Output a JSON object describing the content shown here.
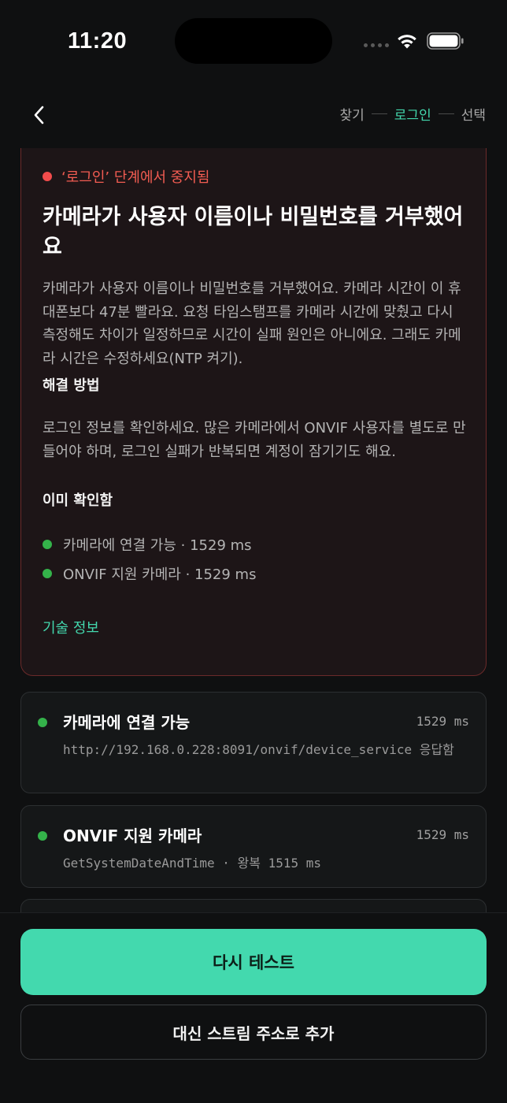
{
  "status_bar": {
    "time": "11:20"
  },
  "nav": {
    "steps": [
      "찾기",
      "로그인",
      "선택"
    ],
    "active_step": "로그인"
  },
  "error": {
    "stage_text": "‘로그인’ 단계에서 중지됨",
    "title": "카메라가 사용자 이름이나 비밀번호를 거부했어요",
    "description": "카메라가 사용자 이름이나 비밀번호를 거부했어요. 카메라 시간이 이 휴대폰보다 47분 빨라요. 요청 타임스탬프를 카메라 시간에 맞췄고 다시 측정해도 차이가 일정하므로 시간이 실패 원인은 아니에요. 그래도 카메라 시간은 수정하세요(NTP 켜기).",
    "fix_title": "해결 방법",
    "fix_text": "로그인 정보를 확인하세요. 많은 카메라에서 ONVIF 사용자를 별도로 만들어야 하며, 로그인 실패가 반복되면 계정이 잠기기도 해요.",
    "checked_title": "이미 확인함",
    "checked_items": [
      "카메라에 연결 가능 · 1529 ms",
      "ONVIF 지원 카메라 · 1529 ms"
    ],
    "tech_link": "기술 정보"
  },
  "steps": [
    {
      "name": "카메라에 연결 가능",
      "time": "1529 ms",
      "detail": "http://192.168.0.228:8091/onvif/device_service 응답함"
    },
    {
      "name": "ONVIF 지원 카메라",
      "time": "1529 ms",
      "detail": "GetSystemDateAndTime · 왕복 1515 ms"
    }
  ],
  "buttons": {
    "retest": "다시 테스트",
    "add_stream": "대신 스트림 주소로 추가"
  },
  "colors": {
    "accent": "#43d9ae",
    "error": "#f24c4c",
    "success": "#34b24a",
    "background": "#0f1011"
  }
}
